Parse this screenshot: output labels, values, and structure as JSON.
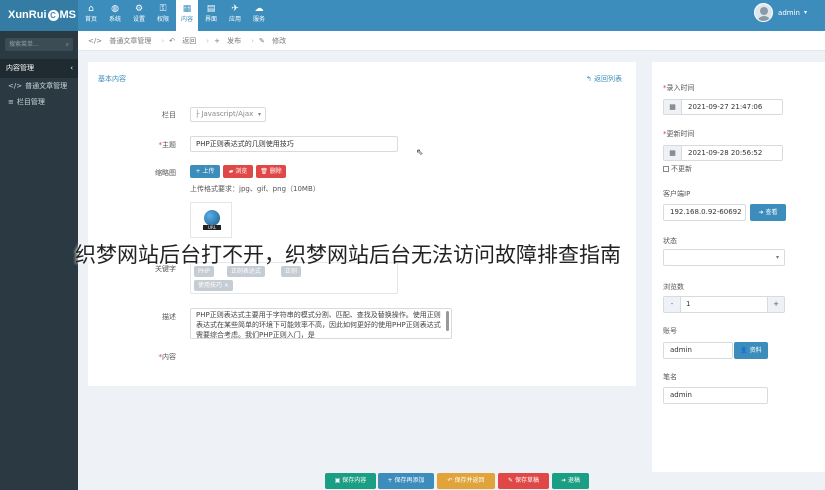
{
  "brand": {
    "logo_left": "XunRui",
    "logo_circle": "C",
    "logo_right": "MS"
  },
  "nav": [
    {
      "icon": "⌂",
      "label": "首页"
    },
    {
      "icon": "◍",
      "label": "系统"
    },
    {
      "icon": "⚙",
      "label": "设置"
    },
    {
      "icon": "⚿",
      "label": "权限"
    },
    {
      "icon": "▦",
      "label": "内容",
      "active": true
    },
    {
      "icon": "▤",
      "label": "界面"
    },
    {
      "icon": "✈",
      "label": "应用"
    },
    {
      "icon": "☁",
      "label": "服务"
    }
  ],
  "user": {
    "name": "admin",
    "caret": "▾"
  },
  "sidebar": {
    "search_placeholder": "搜索菜单...",
    "search_icon": "⌕",
    "group": "内容管理",
    "group_chevron": "‹",
    "items": [
      {
        "icon": "</>",
        "label": "普通文章管理"
      },
      {
        "icon": "≡",
        "label": "栏目管理"
      }
    ]
  },
  "breadcrumb": [
    {
      "icon": "</>",
      "label": "普通文章管理"
    },
    {
      "icon": "↶",
      "label": "返回"
    },
    {
      "icon": "+",
      "label": "发布"
    },
    {
      "icon": "✎",
      "label": "修改"
    }
  ],
  "form": {
    "title": "基本内容",
    "back": "↰ 返回列表",
    "category_label": "栏目",
    "category_value": "├ Javascript/Ajax",
    "category_caret": "▾",
    "subject_label": "主题",
    "subject_value": "PHP正则表达式的几则使用技巧",
    "thumb_label": "缩略图",
    "btn_upload": "+ 上传",
    "btn_browse": "▰ 浏览",
    "btn_delete": "🗑 删除",
    "upload_hint": "上传格式要求：jpg、gif、png（10MB）",
    "thumb_tag": "URL",
    "keywords_label": "关键字",
    "tags": [
      "PHP",
      "正则表达式",
      "正则",
      "使用技巧 ×"
    ],
    "desc_label": "描述",
    "desc_value": "PHP正则表达式主要用于字符串的模式分割、匹配、查找及替换操作。使用正则表达式在某些简单的环境下可能效率不高，因此如何更好的使用PHP正则表达式需要综合考虑。我们PHP正则入门，是",
    "content_label": "内容",
    "req": "*"
  },
  "side": {
    "publish_label": "录入时间",
    "publish_value": "2021-09-27 21:47:06",
    "update_label": "更新时间",
    "update_value": "2021-09-28 20:56:52",
    "no_update": "不更新",
    "ip_label": "客户端IP",
    "ip_value": "192.168.0.92-60692",
    "ip_btn": "➜ 查看",
    "status_label": "状态",
    "views_label": "浏览数",
    "views_value": "1",
    "minus": "-",
    "plus": "+",
    "account_label": "账号",
    "account_value": "admin",
    "account_btn": "👤 资料",
    "author_label": "笔名",
    "author_value": "admin",
    "cal_icon": "▦"
  },
  "footer": [
    {
      "label": "▣ 保存内容",
      "color": "#1a9e84"
    },
    {
      "label": "+ 保存再添加",
      "color": "#3c8dbc"
    },
    {
      "label": "↶ 保存并返回",
      "color": "#e0a43a"
    },
    {
      "label": "✎ 保存草稿",
      "color": "#e04848"
    },
    {
      "label": "➜ 退稿",
      "color": "#1a9e84"
    }
  ],
  "overlay": "织梦网站后台打不开，织梦网站后台无法访问故障排查指南"
}
